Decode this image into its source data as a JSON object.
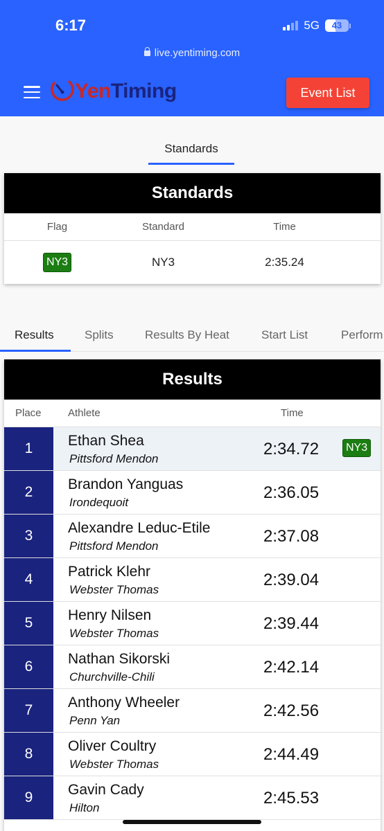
{
  "status_bar": {
    "time": "6:17",
    "network": "5G",
    "battery": "43",
    "battery_level": 0.43
  },
  "browser": {
    "url": "live.yentiming.com"
  },
  "header": {
    "logo_yen": "Yen",
    "logo_timing": "Timing",
    "event_list_label": "Event List"
  },
  "standards": {
    "tab_label": "Standards",
    "title": "Standards",
    "columns": [
      "Flag",
      "Standard",
      "Time"
    ],
    "row": {
      "flag": "NY3",
      "standard": "NY3",
      "time": "2:35.24"
    }
  },
  "tabs": [
    "Results",
    "Splits",
    "Results By Heat",
    "Start List",
    "Perform"
  ],
  "results": {
    "title": "Results",
    "columns": {
      "place": "Place",
      "athlete": "Athlete",
      "time": "Time"
    },
    "rows": [
      {
        "place": "1",
        "name": "Ethan Shea",
        "team": "Pittsford Mendon",
        "time": "2:34.72",
        "flag": "NY3"
      },
      {
        "place": "2",
        "name": "Brandon Yanguas",
        "team": "Irondequoit",
        "time": "2:36.05"
      },
      {
        "place": "3",
        "name": "Alexandre Leduc-Etile",
        "team": "Pittsford Mendon",
        "time": "2:37.08"
      },
      {
        "place": "4",
        "name": "Patrick Klehr",
        "team": "Webster Thomas",
        "time": "2:39.04"
      },
      {
        "place": "5",
        "name": "Henry Nilsen",
        "team": "Webster Thomas",
        "time": "2:39.44"
      },
      {
        "place": "6",
        "name": "Nathan Sikorski",
        "team": "Churchville-Chili",
        "time": "2:42.14"
      },
      {
        "place": "7",
        "name": "Anthony Wheeler",
        "team": "Penn Yan",
        "time": "2:42.56"
      },
      {
        "place": "8",
        "name": "Oliver Coultry",
        "team": "Webster Thomas",
        "time": "2:44.49"
      },
      {
        "place": "9",
        "name": "Gavin Cady",
        "team": "Hilton",
        "time": "2:45.53"
      }
    ]
  },
  "colors": {
    "header_blue": "#2962ff",
    "event_button_red": "#f44336",
    "place_navy": "#1a237e",
    "flag_green": "#1b7d12"
  }
}
